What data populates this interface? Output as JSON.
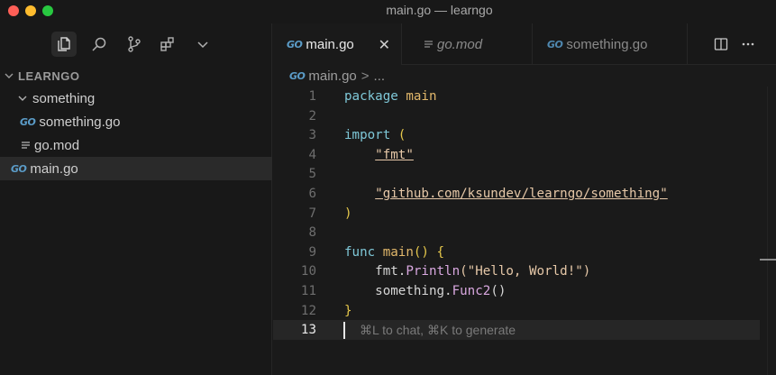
{
  "window": {
    "title": "main.go — learngo"
  },
  "activity_bar": {
    "items": [
      {
        "icon": "files-icon",
        "active": true
      },
      {
        "icon": "search-icon",
        "active": false
      },
      {
        "icon": "source-control-icon",
        "active": false
      },
      {
        "icon": "extensions-icon",
        "active": false
      },
      {
        "icon": "chevron-down-icon",
        "active": false
      }
    ]
  },
  "explorer": {
    "root_label": "LEARNGO",
    "items": [
      {
        "label": "something",
        "type": "folder"
      },
      {
        "label": "something.go",
        "type": "go",
        "icon_text": "GO"
      },
      {
        "label": "go.mod",
        "type": "mod"
      },
      {
        "label": "main.go",
        "type": "go",
        "icon_text": "GO",
        "selected": true
      }
    ]
  },
  "tabs": [
    {
      "label": "main.go",
      "icon_text": "GO",
      "active": true,
      "close": "✕"
    },
    {
      "label": "go.mod",
      "active": false
    },
    {
      "label": "something.go",
      "icon_text": "GO",
      "active": false
    }
  ],
  "breadcrumb": {
    "file": "main.go",
    "icon_text": "GO",
    "separator": ">",
    "more": "..."
  },
  "editor": {
    "line_numbers": [
      "1",
      "2",
      "3",
      "4",
      "5",
      "6",
      "7",
      "8",
      "9",
      "10",
      "11",
      "12",
      "13"
    ],
    "current_line": 13,
    "lines": {
      "l1_kw": "package",
      "l1_id": "main",
      "l3_kw": "import",
      "l3_p": "(",
      "l4_str": "\"fmt\"",
      "l6_str": "\"github.com/ksundev/learngo/something\"",
      "l7_p": ")",
      "l9_kw": "func",
      "l9_id": "main",
      "l9_p": "() {",
      "l10_a": "fmt.",
      "l10_fn": "Println",
      "l10_b": "(\"Hello, World!\")",
      "l11_a": "something.",
      "l11_fn": "Func2",
      "l11_b": "()",
      "l12_p": "}",
      "hint": "⌘L to chat, ⌘K to generate"
    }
  },
  "colors": {
    "keyword": "#7fc8d8",
    "identifier": "#e2b86b",
    "string": "#e6c8a8",
    "function": "#d9a8e0",
    "go_icon": "#5b9cc8"
  }
}
